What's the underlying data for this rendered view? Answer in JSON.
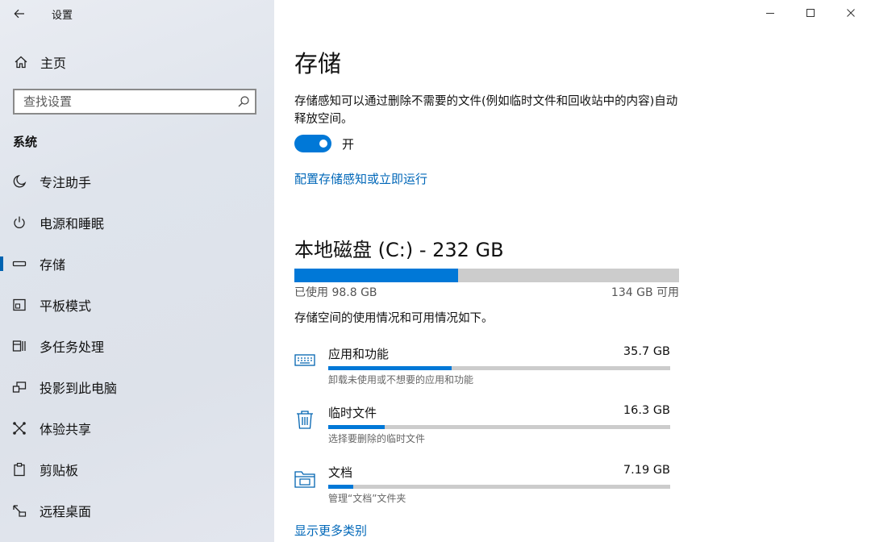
{
  "window": {
    "title": "设置"
  },
  "sidebar": {
    "home_label": "主页",
    "search_placeholder": "查找设置",
    "section_header": "系统",
    "items": [
      {
        "label": "专注助手",
        "icon": "moon-icon"
      },
      {
        "label": "电源和睡眠",
        "icon": "power-icon"
      },
      {
        "label": "存储",
        "icon": "storage-icon",
        "selected": true
      },
      {
        "label": "平板模式",
        "icon": "tablet-mode-icon"
      },
      {
        "label": "多任务处理",
        "icon": "multitasking-icon"
      },
      {
        "label": "投影到此电脑",
        "icon": "project-icon"
      },
      {
        "label": "体验共享",
        "icon": "share-icon"
      },
      {
        "label": "剪贴板",
        "icon": "clipboard-icon"
      },
      {
        "label": "远程桌面",
        "icon": "remote-desktop-icon"
      }
    ]
  },
  "main": {
    "title": "存储",
    "description": "存储感知可以通过删除不需要的文件(例如临时文件和回收站中的内容)自动释放空间。",
    "toggle": {
      "state": true,
      "label": "开"
    },
    "configure_link": "配置存储感知或立即运行",
    "disk": {
      "title": "本地磁盘 (C:) - 232 GB",
      "used_label": "已使用 98.8 GB",
      "free_label": "134 GB 可用",
      "used_fraction": 0.426
    },
    "usage_description": "存储空间的使用情况和可用情况如下。",
    "categories": [
      {
        "name": "应用和功能",
        "size": "35.7 GB",
        "subtitle": "卸载未使用或不想要的应用和功能",
        "fraction": 0.36,
        "icon": "apps-keyboard-icon"
      },
      {
        "name": "临时文件",
        "size": "16.3 GB",
        "subtitle": "选择要删除的临时文件",
        "fraction": 0.165,
        "icon": "trash-icon"
      },
      {
        "name": "文档",
        "size": "7.19 GB",
        "subtitle": "管理“文档”文件夹",
        "fraction": 0.073,
        "icon": "documents-folder-icon"
      }
    ],
    "more_link": "显示更多类别"
  },
  "colors": {
    "accent": "#0078d7",
    "link": "#0067b8",
    "bar_track": "#cccccc"
  }
}
